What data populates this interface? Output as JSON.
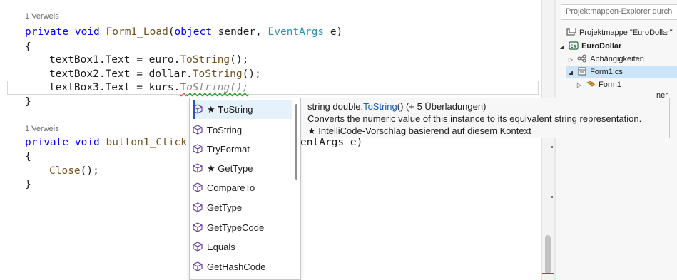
{
  "editor": {
    "method1": {
      "ref": "1 Verweis",
      "sig": {
        "kw1": "private",
        "kw2": "void",
        "name": "Form1_Load",
        "p1": "(",
        "kw3": "object",
        "p2": " sender, ",
        "typ": "EventArgs",
        "p3": " e)"
      },
      "open_brace": "{",
      "line1": {
        "a": "textBox1.Text = euro.",
        "m": "ToString",
        "b": "();"
      },
      "line2": {
        "a": "textBox2.Text = dollar.",
        "m": "ToString",
        "b": "();"
      },
      "line3": {
        "a": "textBox3.Text = kurs.",
        "typed": "T",
        "ghost": "oString();"
      },
      "close_brace": "}"
    },
    "method2": {
      "ref": "1 Verweis",
      "sig": {
        "kw1": "private",
        "kw2": "void",
        "name": "button1_Click(",
        "tail": "entArgs e)"
      },
      "open_brace": "{",
      "line1": {
        "m": "Close",
        "b": "();"
      },
      "close_brace": "}"
    }
  },
  "completion": {
    "items": [
      {
        "star": "★ ",
        "bold": "T",
        "rest": "oString",
        "selected": true
      },
      {
        "star": "",
        "bold": "T",
        "rest": "oString",
        "selected": false
      },
      {
        "star": "",
        "bold": "T",
        "rest": "ryFormat",
        "selected": false
      },
      {
        "star": "★ ",
        "bold": "",
        "rest": "GetType",
        "selected": false
      },
      {
        "star": "",
        "bold": "",
        "rest": "CompareTo",
        "selected": false
      },
      {
        "star": "",
        "bold": "",
        "rest": "GetType",
        "selected": false
      },
      {
        "star": "",
        "bold": "",
        "rest": "GetTypeCode",
        "selected": false
      },
      {
        "star": "",
        "bold": "",
        "rest": "Equals",
        "selected": false
      },
      {
        "star": "",
        "bold": "",
        "rest": "GetHashCode",
        "selected": false
      }
    ],
    "icon": "method-cube-icon"
  },
  "tooltip": {
    "sig_prefix": "string double.",
    "sig_method": "ToString",
    "sig_suffix": "() (+ 5 Überladungen)",
    "description": "Converts the numeric value of this instance to its equivalent string representation.",
    "intellicode": "★  IntelliCode-Vorschlag basierend auf diesem Kontext"
  },
  "solution_explorer": {
    "search_placeholder": "Projektmappen-Explorer durch",
    "items": [
      {
        "label": "Projektmappe \"EuroDollar\"",
        "icon": "solution-icon",
        "bold": false
      },
      {
        "label": "EuroDollar",
        "icon": "csharp-project-icon",
        "bold": true
      },
      {
        "label": "Abhängigkeiten",
        "icon": "dependencies-icon",
        "bold": false
      },
      {
        "label": "Form1.cs",
        "icon": "form-file-icon",
        "bold": false
      },
      {
        "label": "Form1",
        "icon": "form-class-icon",
        "bold": false
      }
    ]
  },
  "colors": {
    "keyword": "#0000ff",
    "type": "#2b91af",
    "method": "#74531f",
    "accent": "#1a5fb4"
  }
}
